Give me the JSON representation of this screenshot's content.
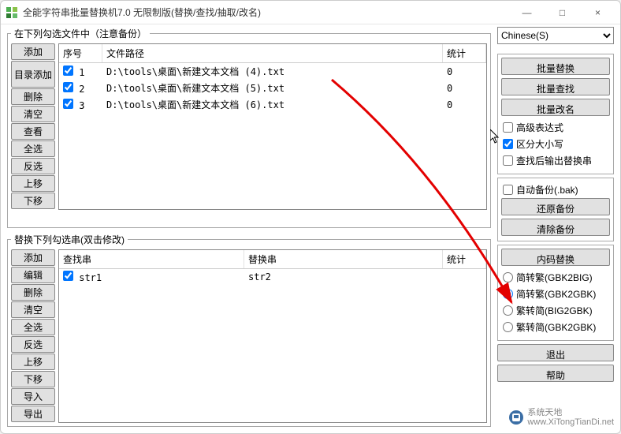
{
  "window": {
    "title": "全能字符串批量替换机7.0 无限制版(替换/查找/抽取/改名)",
    "minimize": "—",
    "maximize": "□",
    "close": "×"
  },
  "panels": {
    "files_legend": "在下列勾选文件中（注意备份）",
    "replace_legend": "替换下列勾选串(双击修改)"
  },
  "file_btns": [
    "添加",
    "目录添加",
    "删除",
    "清空",
    "查看",
    "全选",
    "反选",
    "上移",
    "下移"
  ],
  "replace_btns": [
    "添加",
    "编辑",
    "删除",
    "清空",
    "全选",
    "反选",
    "上移",
    "下移",
    "导入",
    "导出"
  ],
  "file_cols": {
    "seq": "序号",
    "path": "文件路径",
    "count": "统计"
  },
  "replace_cols": {
    "search": "查找串",
    "replace": "替换串",
    "count": "统计"
  },
  "files": [
    {
      "seq": "1",
      "checked": true,
      "path": "D:\\tools\\桌面\\新建文本文档 (4).txt",
      "count": "0"
    },
    {
      "seq": "2",
      "checked": true,
      "path": "D:\\tools\\桌面\\新建文本文档 (5).txt",
      "count": "0"
    },
    {
      "seq": "3",
      "checked": true,
      "path": "D:\\tools\\桌面\\新建文本文档 (6).txt",
      "count": "0"
    }
  ],
  "replaces": [
    {
      "checked": true,
      "search": "str1",
      "replace": "str2",
      "count": ""
    }
  ],
  "right": {
    "encoding": "Chinese(S)",
    "batch_replace": "批量替换",
    "batch_find": "批量查找",
    "batch_rename": "批量改名",
    "adv_expr": "高级表达式",
    "case_sens": "区分大小写",
    "output_after": "查找后输出替换串",
    "auto_backup": "自动备份(.bak)",
    "restore_backup": "还原备份",
    "clear_backup": "清除备份",
    "encode_replace": "内码替换",
    "r1": "简转繁(GBK2BIG)",
    "r2": "简转繁(GBK2GBK)",
    "r3": "繁转简(BIG2GBK)",
    "r4": "繁转简(GBK2GBK)",
    "exit": "退出",
    "help": "帮助"
  },
  "checks": {
    "adv_expr": false,
    "case_sens": true,
    "output_after": false,
    "auto_backup": false
  },
  "radio_sel": "r2",
  "watermark": {
    "t1": "系统天地",
    "t2": "www.XiTongTianDi.net"
  }
}
